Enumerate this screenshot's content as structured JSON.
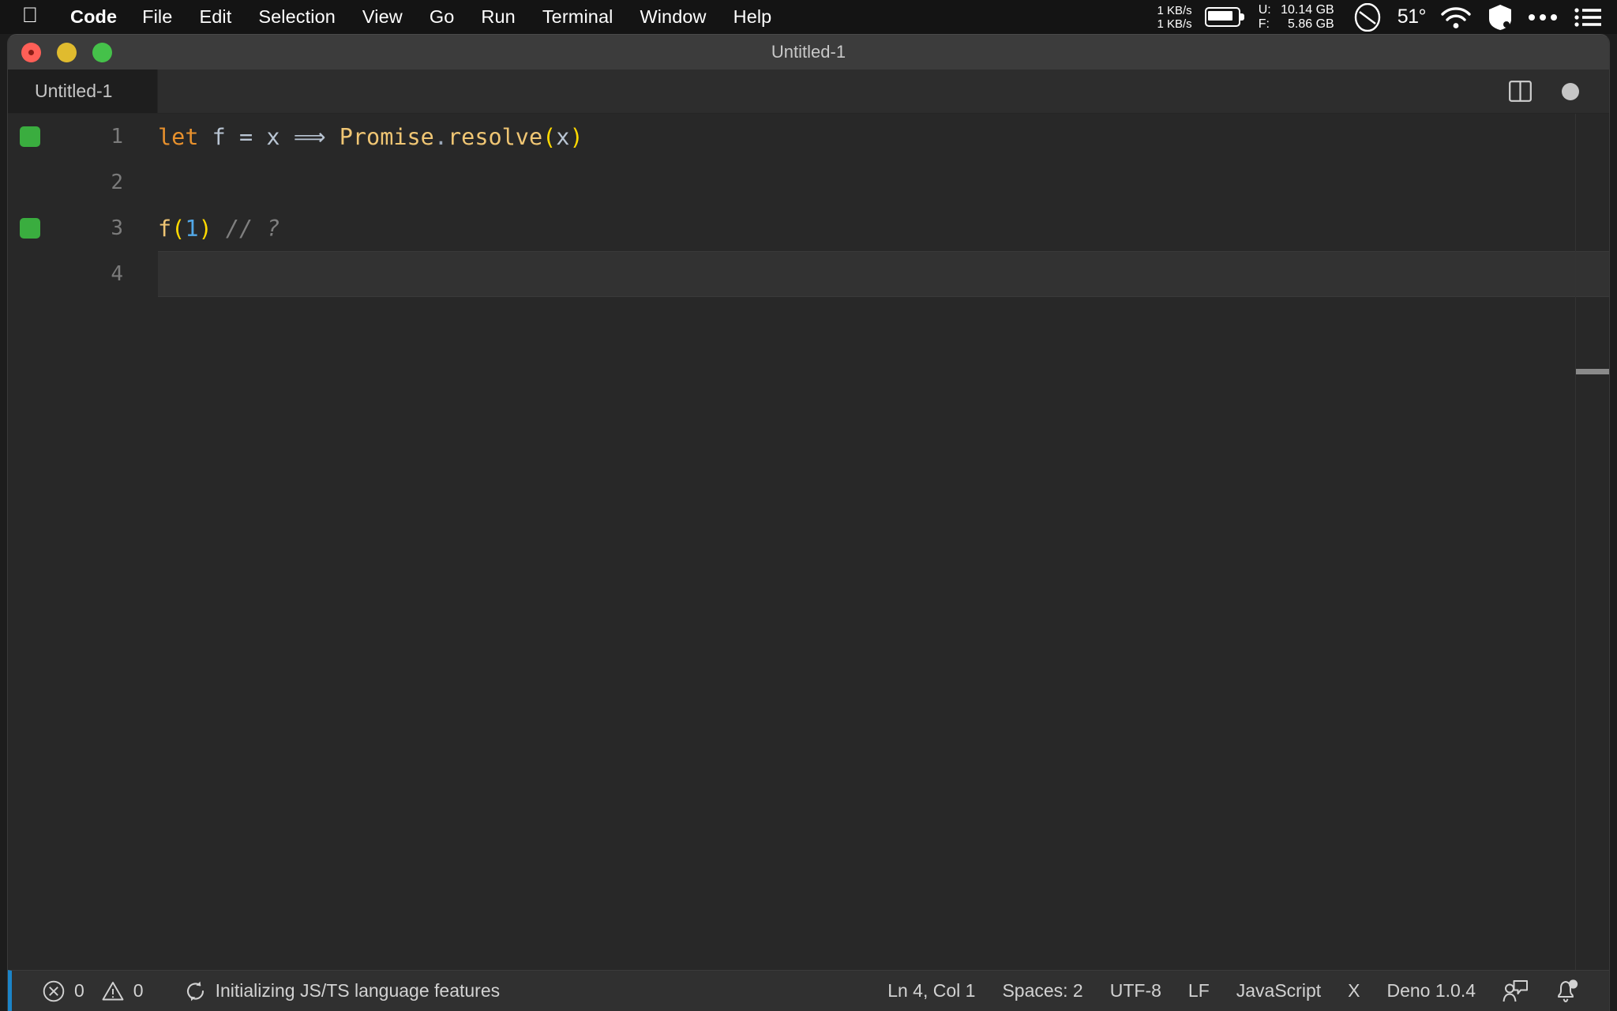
{
  "menubar": {
    "apple_icon": "apple-logo-icon",
    "items": [
      {
        "label": "Code",
        "bold": true
      },
      {
        "label": "File",
        "bold": false
      },
      {
        "label": "Edit",
        "bold": false
      },
      {
        "label": "Selection",
        "bold": false
      },
      {
        "label": "View",
        "bold": false
      },
      {
        "label": "Go",
        "bold": false
      },
      {
        "label": "Run",
        "bold": false
      },
      {
        "label": "Terminal",
        "bold": false
      },
      {
        "label": "Window",
        "bold": false
      },
      {
        "label": "Help",
        "bold": false
      }
    ],
    "status": {
      "net_up": "1 KB/s",
      "net_down": "1 KB/s",
      "battery_icon": "battery-icon",
      "mem_used_label": "U:",
      "mem_used_value": "10.14 GB",
      "mem_free_label": "F:",
      "mem_free_value": "5.86 GB",
      "ghost_icon": "ghost-circle-icon",
      "temperature": "51°",
      "wifi_icon": "wifi-icon",
      "shield_icon": "shield-icon",
      "more_icon": "ellipsis-icon",
      "control_center_icon": "list-menu-icon"
    }
  },
  "window": {
    "title": "Untitled-1",
    "traffic_lights": {
      "close": "close-button",
      "minimize": "minimize-button",
      "zoom": "zoom-button"
    }
  },
  "tabbar": {
    "tabs": [
      {
        "label": "Untitled-1",
        "active": true
      }
    ],
    "actions": {
      "split_editor": "split-editor-icon",
      "unsaved_indicator": "unsaved-dot-indicator"
    }
  },
  "editor": {
    "lines": [
      {
        "number": "1",
        "has_run_marker": true,
        "active": false,
        "tokens": [
          {
            "text": "let",
            "type": "keyword"
          },
          {
            "text": " ",
            "type": "plain"
          },
          {
            "text": "f",
            "type": "ident"
          },
          {
            "text": " ",
            "type": "plain"
          },
          {
            "text": "=",
            "type": "op"
          },
          {
            "text": " ",
            "type": "plain"
          },
          {
            "text": "x",
            "type": "ident"
          },
          {
            "text": " ",
            "type": "plain"
          },
          {
            "text": "⟹",
            "type": "op"
          },
          {
            "text": " ",
            "type": "plain"
          },
          {
            "text": "Promise",
            "type": "class"
          },
          {
            "text": ".",
            "type": "dot"
          },
          {
            "text": "resolve",
            "type": "func"
          },
          {
            "text": "(",
            "type": "paren"
          },
          {
            "text": "x",
            "type": "ident"
          },
          {
            "text": ")",
            "type": "paren"
          }
        ]
      },
      {
        "number": "2",
        "has_run_marker": false,
        "active": false,
        "tokens": []
      },
      {
        "number": "3",
        "has_run_marker": true,
        "active": false,
        "tokens": [
          {
            "text": "f",
            "type": "func"
          },
          {
            "text": "(",
            "type": "paren"
          },
          {
            "text": "1",
            "type": "num"
          },
          {
            "text": ")",
            "type": "paren"
          },
          {
            "text": " ",
            "type": "plain"
          },
          {
            "text": "// ?",
            "type": "comment"
          }
        ]
      },
      {
        "number": "4",
        "has_run_marker": false,
        "active": true,
        "tokens": []
      }
    ],
    "raw_text": "let f = x ⟹ Promise.resolve(x)\n\nf(1) // ?\n"
  },
  "statusbar": {
    "errors_icon": "error-circle-icon",
    "errors_count": "0",
    "warnings_icon": "warning-triangle-icon",
    "warnings_count": "0",
    "task_icon": "sync-spinner-icon",
    "task_text": "Initializing JS/TS language features",
    "cursor_position": "Ln 4, Col 1",
    "indentation": "Spaces: 2",
    "encoding": "UTF-8",
    "eol": "LF",
    "language_mode": "JavaScript",
    "close_label": "X",
    "runtime": "Deno 1.0.4",
    "feedback_icon": "feedback-person-icon",
    "bell_icon": "notification-bell-icon",
    "accent_color": "#1b84c8"
  },
  "colors": {
    "keyword": "#e8912d",
    "class": "#f0c674",
    "paren": "#ffd900",
    "number": "#52a8e8",
    "comment": "#7f7f7f",
    "identifier": "#b9c5d3",
    "run_marker": "#3aad3f",
    "editor_bg": "#282828",
    "tabbar_bg": "#2d2d2d",
    "statusbar_bg": "#303030",
    "titlebar_bg": "#3c3c3c"
  }
}
